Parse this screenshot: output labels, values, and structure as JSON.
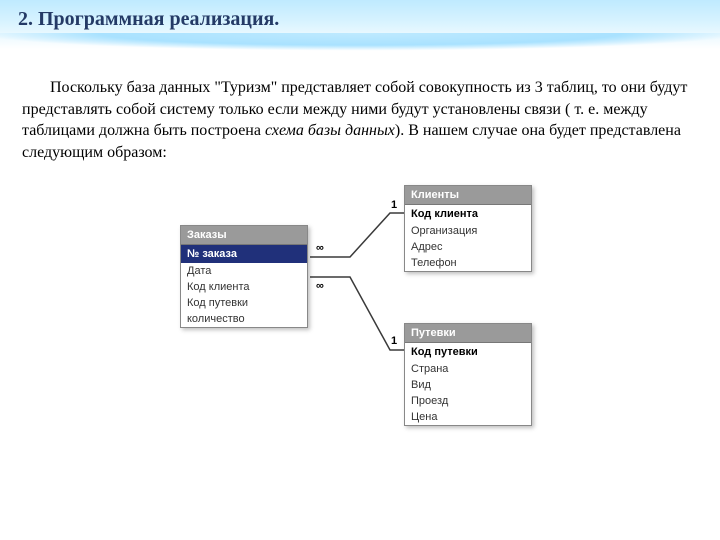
{
  "header": {
    "title": "2. Программная реализация."
  },
  "paragraph": {
    "p1a": "Поскольку база данных \"Туризм\" представляет собой совокупность из 3 таблиц, то они будут представлять собой систему только если между ними будут установлены связи ( т. е. между таблицами должна быть построена ",
    "p1italic": "схема базы данных",
    "p1b": "). В нашем случае она будет представлена следующим образом:"
  },
  "tables": {
    "orders": {
      "title": "Заказы",
      "pk": "№ заказа",
      "rows": [
        "Дата",
        "Код клиента",
        "Код путевки",
        "количество"
      ]
    },
    "clients": {
      "title": "Клиенты",
      "pk": "Код клиента",
      "rows": [
        "Организация",
        "Адрес",
        "Телефон"
      ]
    },
    "tours": {
      "title": "Путевки",
      "pk": "Код путевки",
      "rows": [
        "Страна",
        "Вид",
        "Проезд",
        "Цена"
      ]
    }
  },
  "relations": {
    "one_top": "1",
    "many_top": "∞",
    "one_bottom": "1",
    "many_bottom": "∞"
  }
}
